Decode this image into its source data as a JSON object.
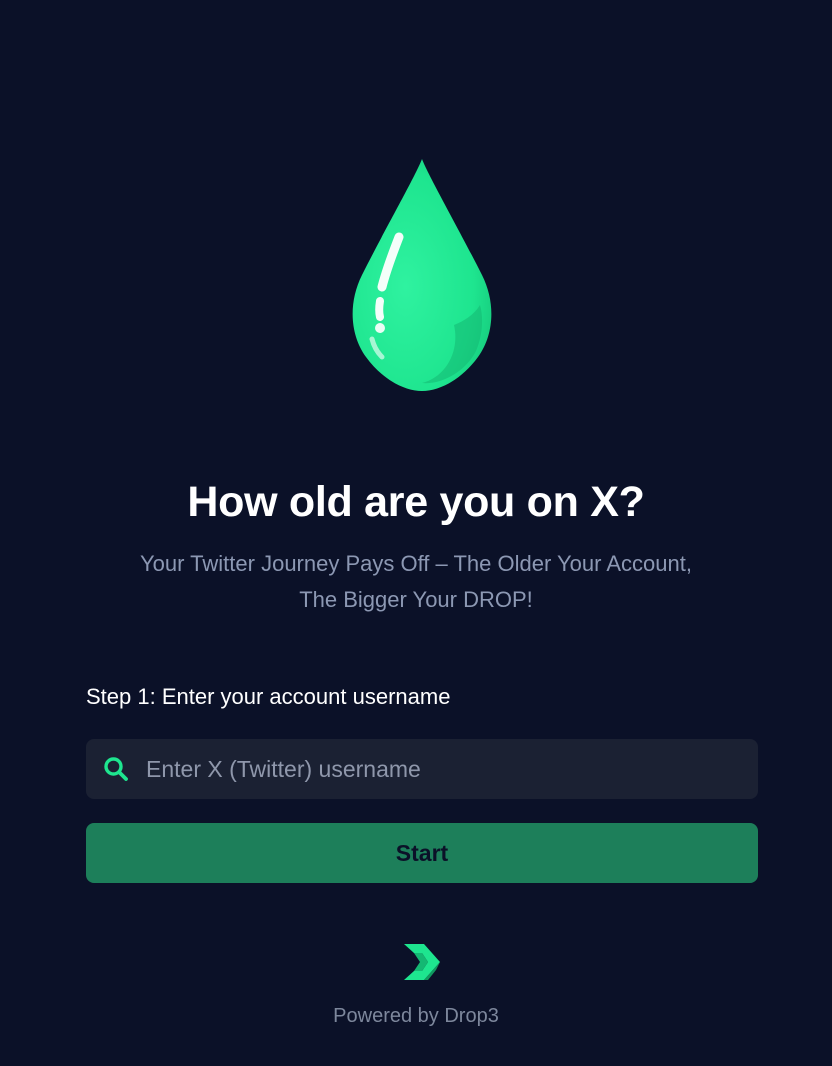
{
  "header": {
    "title": "How old are you on X?",
    "subtitle_line1": "Your Twitter Journey Pays Off – The Older Your Account,",
    "subtitle_line2": "The Bigger Your DROP!"
  },
  "form": {
    "step_label": "Step 1: Enter your account username",
    "search": {
      "placeholder": "Enter X (Twitter) username",
      "value": "",
      "icon": "search-icon"
    },
    "start_label": "Start"
  },
  "footer": {
    "powered_by": "Powered by Drop3",
    "brand_icon": "drop3-logo-icon"
  },
  "colors": {
    "background": "#0b1128",
    "accent": "#1ee58f",
    "button": "#1d7f5a",
    "input_bg": "#1b2133",
    "subtitle": "#8c98b3"
  }
}
